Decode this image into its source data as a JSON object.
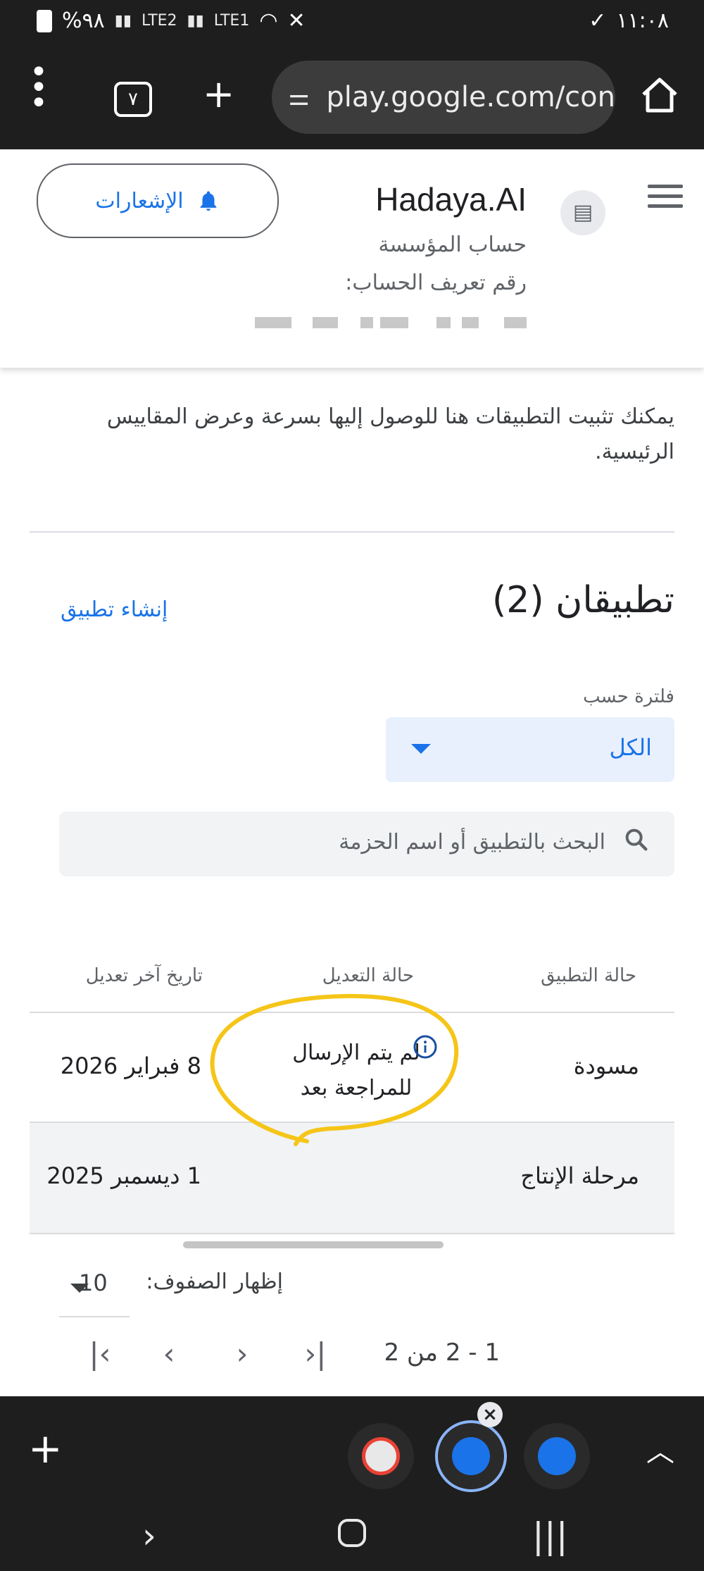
{
  "status_bar": {
    "battery": "%٩٨",
    "network1": "LTE2",
    "network2": "LTE1",
    "time": "١١:٠٨"
  },
  "browser": {
    "tab_count": "٧",
    "url": "play.google.com/con"
  },
  "header": {
    "developer_name": "Hadaya.AI",
    "account_type": "حساب المؤسسة",
    "account_id_label": "رقم تعريف الحساب:",
    "notifications_label": "الإشعارات"
  },
  "pinned": {
    "description": "يمكنك تثبيت التطبيقات هنا للوصول إليها بسرعة وعرض المقاييس الرئيسية."
  },
  "apps": {
    "title": "تطبيقان (2)",
    "create_label": "إنشاء تطبيق",
    "filter_label": "فلترة حسب",
    "filter_value": "الكل",
    "search_placeholder": "البحث بالتطبيق أو اسم الحزمة",
    "columns": [
      "حالة التطبيق",
      "حالة التعديل",
      "تاريخ آخر تعديل"
    ],
    "rows": [
      {
        "app_status": "مسودة",
        "edit_status": "لم يتم الإرسال للمراجعة بعد",
        "last_updated": "8 فبراير 2026"
      },
      {
        "app_status": "مرحلة الإنتاج",
        "edit_status": "",
        "last_updated": "1 ديسمبر 2025"
      }
    ]
  },
  "pagination": {
    "rows_label": "إظهار الصفوف:",
    "rows_value": "10",
    "range": "1 - 2 من 2"
  },
  "colors": {
    "accent": "#1a73e8",
    "highlight_circle": "#f5c518",
    "row_selected_bg": "#f1f3f4"
  }
}
